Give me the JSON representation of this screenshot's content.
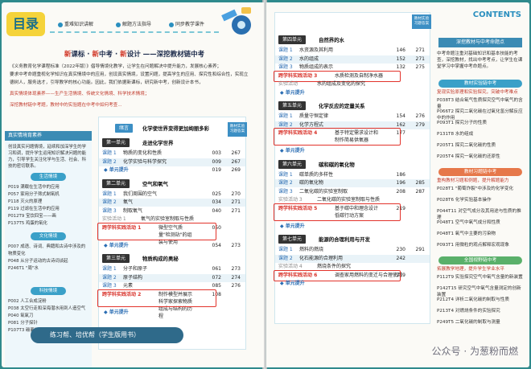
{
  "left_page": {
    "toc_label": "目录",
    "nav": [
      "重难知识讲解",
      "解题方法指导",
      "同步教学课件"
    ],
    "slogan": {
      "part1": "新",
      "part2": "课标 · ",
      "part3": "新",
      "part4": "中考 · ",
      "part5": "新",
      "part6": "设计 ——深挖教材链中考"
    },
    "intro": [
      "《义务教育化学课程标准（2022年版）》倡导情境化教学，让学生在问题解决中提升能力，发展核心素养；",
      "要求中考命题重视化学知识在真实情境中的应用，创设真实情境，设置问题，提高学生的应用、探究性和综合性，实现立",
      "德树人，服务选才，引导教学的核心功能。因此，我们依据新课标，研究新中考，创新设计本书，",
      "真实情境体现素养——生产生活情境、传统文化情境、科学技术情境；",
      "深挖教材链中考题，教材中的实验题在中考中如何考查..."
    ],
    "left_col": {
      "title": "真实情境育素养",
      "text": "创设真实问题情境，延续和加深学生的学习和调，提升学生运用知识解决问题的能力，引导学生关注化学与生活、社会、科技的密切联系。",
      "sections": [
        {
          "chip": "生活情境",
          "items": [
            "P019 满载在生活中的应用",
            "P057 家用分子筛式制氧机",
            "P118 灭火的原理",
            "P119 过滤在生活中的应用",
            "P012T9 宝饮四宝——画",
            "P137T5 鸡蛋的氧化"
          ]
        },
        {
          "chip": "文化情境",
          "items": [
            "P007 成语、诗词、典籍和古诗中涉及的物质变化",
            "P048 从分子运动的古诗词谈起",
            "P246T1 \"周\"水"
          ]
        },
        {
          "chip": "科技情境",
          "items": [
            "P002 人工合成淀粉",
            "P038 太空行走和深海潜水用到人造空气",
            "P040 氧氧刀",
            "P081 分子探针",
            "P107T3 碳离子电池"
          ]
        }
      ]
    },
    "toc": {
      "side_tab": "教材实验 习题答案",
      "header": {
        "tag": "绪言",
        "title": "化学使世界变得更加绚丽多彩"
      },
      "units": [
        {
          "label": "第一单元",
          "title": "走进化学世界",
          "rows": [
            {
              "lesson": "课题 1",
              "name": "物质的变化和性质",
              "p1": "003",
              "p2": "267",
              "kind": "normal"
            },
            {
              "lesson": "课题 2",
              "name": "化学实验与科学探究",
              "p1": "009",
              "p2": "267",
              "kind": "alt"
            },
            {
              "lesson": "",
              "name": "◆ 单元提升",
              "p1": "019",
              "p2": "269",
              "kind": "unit"
            }
          ]
        },
        {
          "label": "第二单元",
          "title": "空气和氧气",
          "rows": [
            {
              "lesson": "课题 1",
              "name": "我们周围的空气",
              "p1": "025",
              "p2": "270",
              "kind": "normal"
            },
            {
              "lesson": "课题 2",
              "name": "氧气",
              "p1": "034",
              "p2": "271",
              "kind": "alt"
            },
            {
              "lesson": "课题 3",
              "name": "制取氧气",
              "p1": "040",
              "p2": "271",
              "kind": "normal"
            },
            {
              "lesson": "实验活动 1",
              "name": "氧气的实验室制取与性质",
              "p1": "",
              "p2": "",
              "kind": "exp"
            },
            {
              "lesson": "跨学科实践活动 1",
              "name": "微型空气质量\"检测站\"的组装与使用",
              "p1": "050",
              "p2": "",
              "kind": "cross"
            },
            {
              "lesson": "",
              "name": "◆ 单元提升",
              "p1": "054",
              "p2": "273",
              "kind": "unit"
            }
          ]
        },
        {
          "label": "第三单元",
          "title": "物质构成的奥秘",
          "rows": [
            {
              "lesson": "课题 1",
              "name": "分子和原子",
              "p1": "061",
              "p2": "273",
              "kind": "normal"
            },
            {
              "lesson": "课题 2",
              "name": "原子结构",
              "p1": "072",
              "p2": "274",
              "kind": "alt"
            },
            {
              "lesson": "课题 3",
              "name": "元素",
              "p1": "085",
              "p2": "276",
              "kind": "normal"
            },
            {
              "lesson": "跨学科实践活动 2",
              "name": "制作模型并展示科学家探索物质组成与结构的历程",
              "p1": "108",
              "p2": "",
              "kind": "cross"
            },
            {
              "lesson": "",
              "name": "◆ 单元提升",
              "p1": "",
              "p2": "",
              "kind": "unit"
            }
          ]
        }
      ]
    }
  },
  "right_page": {
    "side_tab": "教材实验 习题答案",
    "contents_label": "CONTENTS",
    "units": [
      {
        "label": "第四单元",
        "title": "自然界的水",
        "rows": [
          {
            "lesson": "课题 1",
            "name": "水资源及其利用",
            "p1": "146",
            "p2": "271",
            "kind": "normal"
          },
          {
            "lesson": "课题 2",
            "name": "水的组成",
            "p1": "152",
            "p2": "271",
            "kind": "alt"
          },
          {
            "lesson": "课题 3",
            "name": "物质组成的表示",
            "p1": "132",
            "p2": "275",
            "kind": "normal"
          },
          {
            "lesson": "跨学科实践活动 3",
            "name": "水质检测及自制净水器",
            "p1": "",
            "p2": "",
            "kind": "cross"
          },
          {
            "lesson": "实验活动",
            "name": "水的组成及变化的探究",
            "p1": "",
            "p2": "",
            "kind": "exp"
          },
          {
            "lesson": "",
            "name": "◆ 单元提升",
            "p1": "",
            "p2": "",
            "kind": "unit"
          }
        ]
      },
      {
        "label": "第五单元",
        "title": "化学反应的定量关系",
        "rows": [
          {
            "lesson": "课题 1",
            "name": "质量守恒定律",
            "p1": "154",
            "p2": "276",
            "kind": "normal"
          },
          {
            "lesson": "课题 2",
            "name": "化学方程式",
            "p1": "162",
            "p2": "279",
            "kind": "alt"
          },
          {
            "lesson": "跨学科实践活动 4",
            "name": "基于特定需求设计和制作简易供氧器",
            "p1": "177",
            "p2": "",
            "kind": "cross"
          },
          {
            "lesson": "",
            "name": "◆ 单元提升",
            "p1": "",
            "p2": "",
            "kind": "unit"
          }
        ]
      },
      {
        "label": "第六单元",
        "title": "碳和碳的氧化物",
        "rows": [
          {
            "lesson": "课题 1",
            "name": "碳单质的多样性",
            "p1": "186",
            "p2": "",
            "kind": "normal"
          },
          {
            "lesson": "课题 2",
            "name": "碳的氧化物",
            "p1": "196",
            "p2": "285",
            "kind": "alt"
          },
          {
            "lesson": "课题 3",
            "name": "二氧化碳的实验室制取",
            "p1": "208",
            "p2": "287",
            "kind": "normal"
          },
          {
            "lesson": "实验活动 3",
            "name": "二氧化碳的实验室制取与性质",
            "p1": "",
            "p2": "",
            "kind": "exp"
          },
          {
            "lesson": "跨学科实践活动 5",
            "name": "基于碳中和理念设计低碳行动方案",
            "p1": "219",
            "p2": "",
            "kind": "cross"
          },
          {
            "lesson": "",
            "name": "◆ 单元提升",
            "p1": "",
            "p2": "",
            "kind": "unit"
          }
        ]
      },
      {
        "label": "第七单元",
        "title": "能源的合理利用与开发",
        "rows": [
          {
            "lesson": "课题 1",
            "name": "燃料的燃烧",
            "p1": "230",
            "p2": "291",
            "kind": "normal"
          },
          {
            "lesson": "课题 2",
            "name": "化石能源的合理利用",
            "p1": "242",
            "p2": "",
            "kind": "alt"
          },
          {
            "lesson": "实验活动 4",
            "name": "燃烧条件的探究",
            "p1": "",
            "p2": "",
            "kind": "exp"
          },
          {
            "lesson": "跨学科实践活动 6",
            "name": "调查家用燃料的变迁与合理使用",
            "p1": "259",
            "p2": "",
            "kind": "cross"
          },
          {
            "lesson": "",
            "name": "◆ 单元提升",
            "p1": "",
            "p2": "",
            "kind": "unit"
          }
        ]
      }
    ],
    "right_col": {
      "title": "深挖教材与中考命题点",
      "text": "中考命题注重对基础知识和基本技能的考查，深挖教材，找出中考考点，让学生在课堂学习中掌握中考命题点。",
      "sections": [
        {
          "head": "教材实验链中考",
          "note": "复现实验原理和实验探究，突破中考难点",
          "items": [
            "P038T3 结合氧气性质探究空气中氧气的含量",
            "P066T2 探究二氧化碳在过氧化氢分解反应中的作用",
            "P093T1 探究分子的性质",
            "P131T8 水的组成",
            "P205T1 探究二氧化碳的性质",
            "P205T4 探究一氧化碳的还原性"
          ]
        },
        {
          "head": "教材习题链中考",
          "note": "重构教材习题和例题，提升解题能力",
          "items": [
            "P028T1 \"葡萄炸裂\"中涉及的化学变化",
            "P028T6 化学实验基本操作",
            "P044T11 对空气成分及其用途与性质的推理",
            "P048T1 空气中氧气成分和性质",
            "P048T1 氧气中主要的污染物",
            "P093T1 用微粒的观点解释宏观现象"
          ]
        },
        {
          "head": "全国视野链中考",
          "note": "拓展教学地理，提升学生学业水平",
          "items": [
            "P112T9 实验探究空气中氧气含量的新装置",
            "P142T15 研究空气中氧气含量测定的创新装置",
            "P212T4 详析二氧化碳的制取与性质",
            "P213T4 对燃烧条件的实验探究",
            "P249T5 二氧化碳的制取与测量"
          ]
        }
      ]
    },
    "bottom_banner": "练习帮、培优帮（学生版用书）",
    "watermark": "公众号 · 为葱粉而燃"
  }
}
